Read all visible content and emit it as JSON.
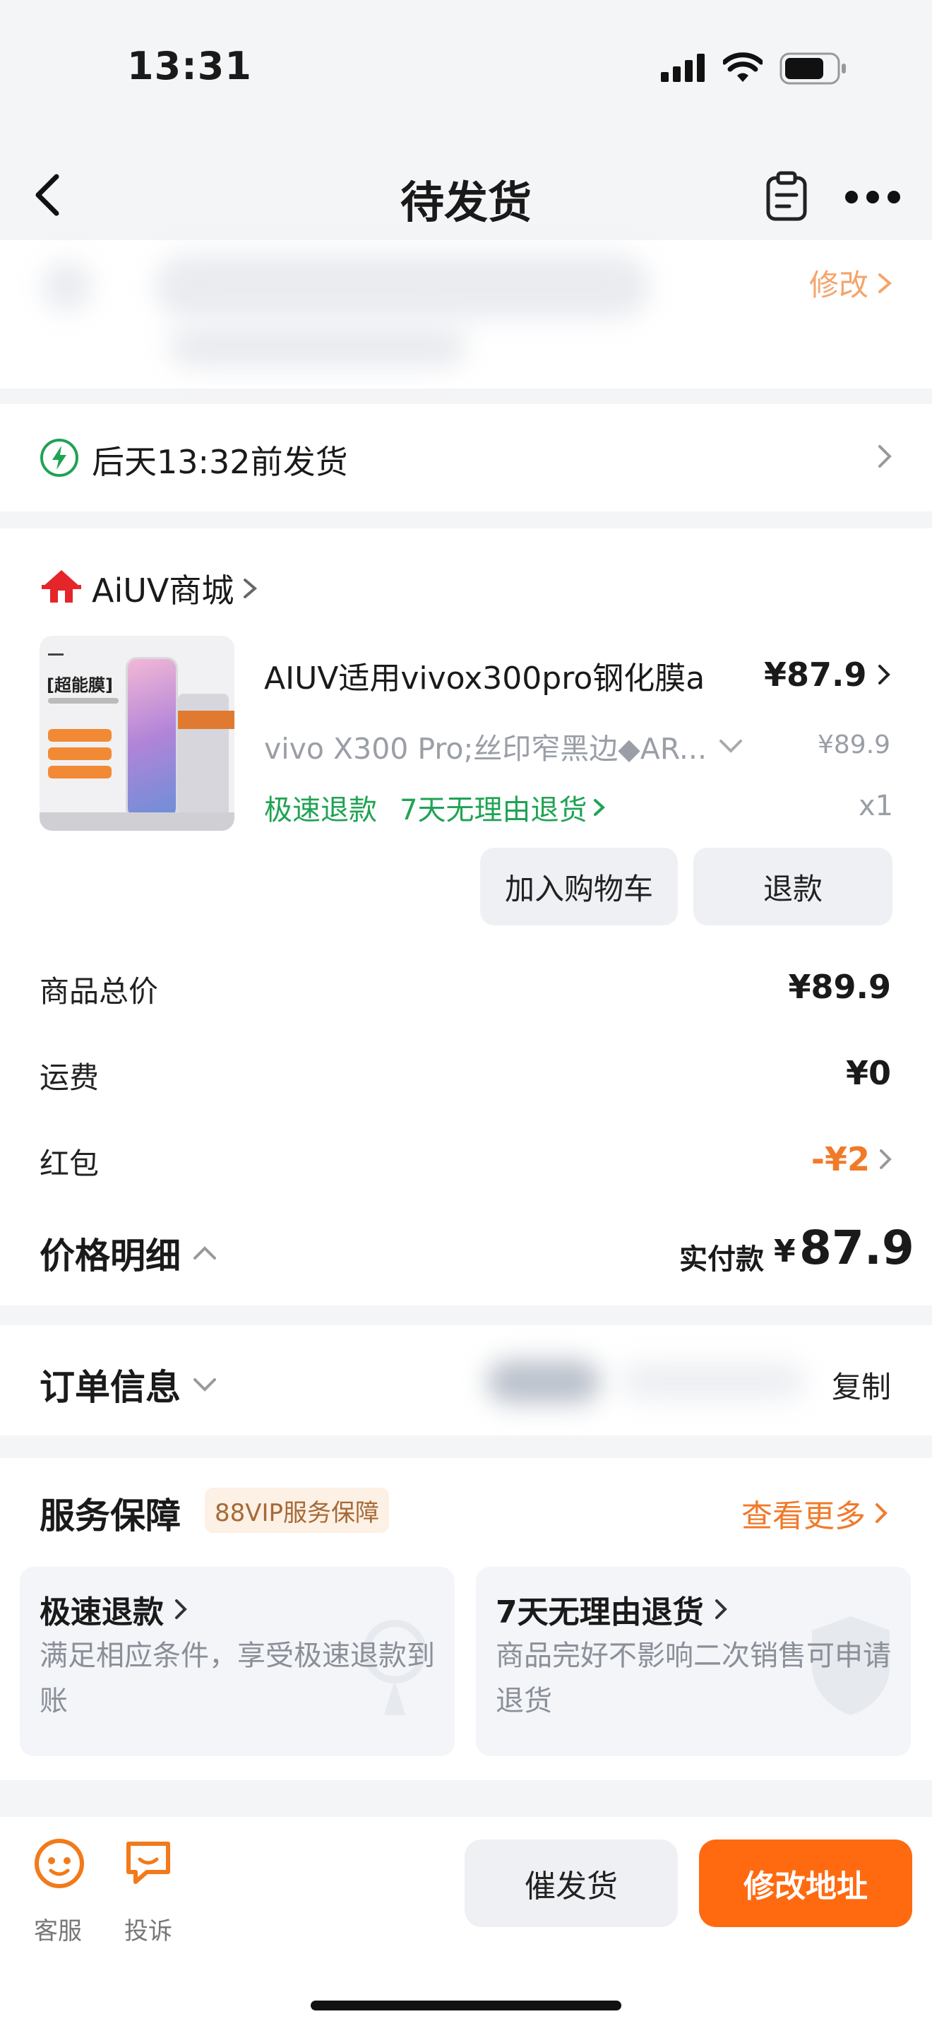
{
  "status_bar": {
    "time": "13:31"
  },
  "nav": {
    "title": "待发货"
  },
  "address": {
    "edit_label": "修改"
  },
  "shipping": {
    "text": "后天13:32前发货"
  },
  "store": {
    "name": "AiUV商城"
  },
  "product": {
    "title": "AIUV适用vivox300pro钢化膜a",
    "price": "¥87.9",
    "spec": "vivo X300 Pro;丝印窄黑边◆AR...",
    "original_price": "¥89.9",
    "tag_fast_refund": "极速退款",
    "tag_7day_return": "7天无理由退货",
    "quantity": "x1",
    "image_badge": "[超能膜]",
    "add_to_cart_label": "加入购物车",
    "refund_label": "退款"
  },
  "price_breakdown": {
    "rows": [
      {
        "label": "商品总价",
        "value": "¥89.9"
      },
      {
        "label": "运费",
        "value": "¥0"
      },
      {
        "label": "红包",
        "value": "-¥2"
      }
    ],
    "detail_label": "价格明细",
    "paid_label": "实付款",
    "paid_currency": "¥",
    "paid_value": "87.9"
  },
  "order_info": {
    "label": "订单信息",
    "copy_label": "复制"
  },
  "service": {
    "title": "服务保障",
    "vip_badge": "88VIP服务保障",
    "see_more": "查看更多",
    "items": [
      {
        "title": "极速退款",
        "desc": "满足相应条件，享受极速退款到账"
      },
      {
        "title": "7天无理由退货",
        "desc": "商品完好不影响二次销售可申请退货"
      }
    ]
  },
  "bottom_bar": {
    "service_label": "客服",
    "complain_label": "投诉",
    "urge_label": "催发货",
    "change_address_label": "修改地址"
  },
  "colors": {
    "accent_orange": "#ff6a10",
    "green": "#1fa354",
    "red_packet": "#f07a2a",
    "store_logo_red": "#e4262b"
  }
}
